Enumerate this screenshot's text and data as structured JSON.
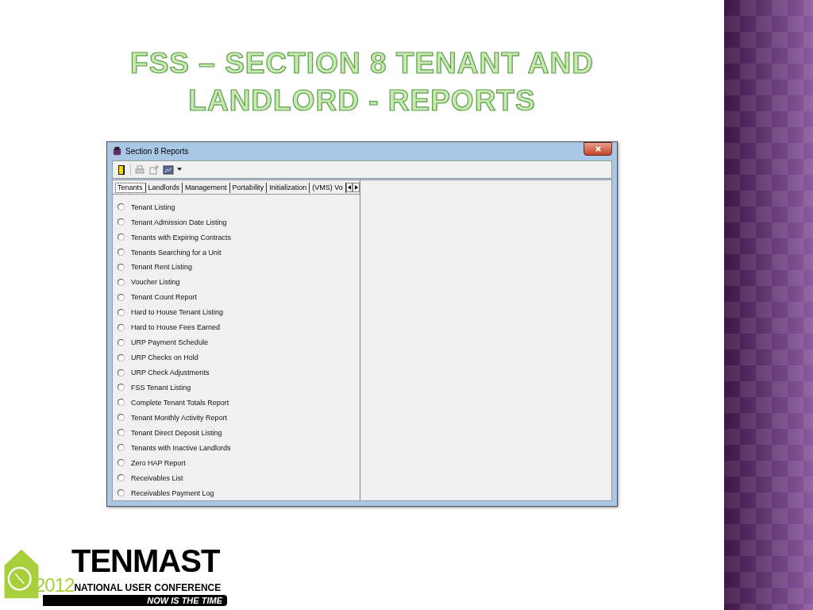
{
  "slide": {
    "title": "FSS – SECTION 8 TENANT AND LANDLORD - REPORTS"
  },
  "window": {
    "title": "Section 8 Reports"
  },
  "tabs": [
    {
      "label": "Tenants",
      "selected": true
    },
    {
      "label": "Landlords",
      "selected": false
    },
    {
      "label": "Management",
      "selected": false
    },
    {
      "label": "Portability",
      "selected": false
    },
    {
      "label": "Initialization",
      "selected": false
    },
    {
      "label": "(VMS) Vo",
      "selected": false
    }
  ],
  "reports": [
    {
      "label": "Tenant Listing",
      "selected": false
    },
    {
      "label": "Tenant Admission Date Listing",
      "selected": false
    },
    {
      "label": "Tenants with Expiring Contracts",
      "selected": false
    },
    {
      "label": "Tenants Searching for a Unit",
      "selected": false
    },
    {
      "label": "Tenant Rent Listing",
      "selected": false
    },
    {
      "label": "Voucher Listing",
      "selected": false
    },
    {
      "label": "Tenant Count Report",
      "selected": false
    },
    {
      "label": "Hard to House Tenant Listing",
      "selected": false
    },
    {
      "label": "Hard to House Fees Earned",
      "selected": false
    },
    {
      "label": "URP Payment Schedule",
      "selected": false
    },
    {
      "label": "URP Checks on Hold",
      "selected": false
    },
    {
      "label": "URP Check Adjustments",
      "selected": false
    },
    {
      "label": "FSS Tenant Listing",
      "selected": false
    },
    {
      "label": "Complete Tenant Totals Report",
      "selected": false
    },
    {
      "label": "Tenant Monthly Activity Report",
      "selected": false
    },
    {
      "label": "Tenant Direct Deposit Listing",
      "selected": false
    },
    {
      "label": "Tenants with Inactive Landlords",
      "selected": false
    },
    {
      "label": "Zero HAP Report",
      "selected": false
    },
    {
      "label": "Receivables List",
      "selected": false
    },
    {
      "label": "Receivables Payment Log",
      "selected": false
    }
  ],
  "logo": {
    "name": "TENMAST",
    "year": "2012",
    "subtitle": "NATIONAL USER CONFERENCE",
    "tagline": "NOW IS THE TIME"
  }
}
